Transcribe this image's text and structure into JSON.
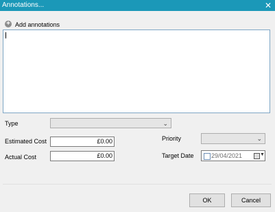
{
  "window": {
    "title": "Annotations...",
    "close_glyph": "✕"
  },
  "add_annotations": {
    "icon": "plus-circle-icon",
    "icon_glyph": "+",
    "label": "Add annotations"
  },
  "annotation_text": "",
  "fields": {
    "type": {
      "label": "Type",
      "value": ""
    },
    "estimated_cost": {
      "label": "Estimated Cost",
      "value": "£0.00"
    },
    "actual_cost": {
      "label": "Actual Cost",
      "value": "£0.00"
    },
    "priority": {
      "label": "Priority",
      "value": ""
    },
    "target_date": {
      "label": "Target Date",
      "value": "29/04/2021",
      "checked": false
    }
  },
  "buttons": {
    "ok": "OK",
    "cancel": "Cancel"
  },
  "chevron_glyph": "⌄",
  "colors": {
    "titlebar": "#1b98b8",
    "background": "#f0f0f0"
  }
}
